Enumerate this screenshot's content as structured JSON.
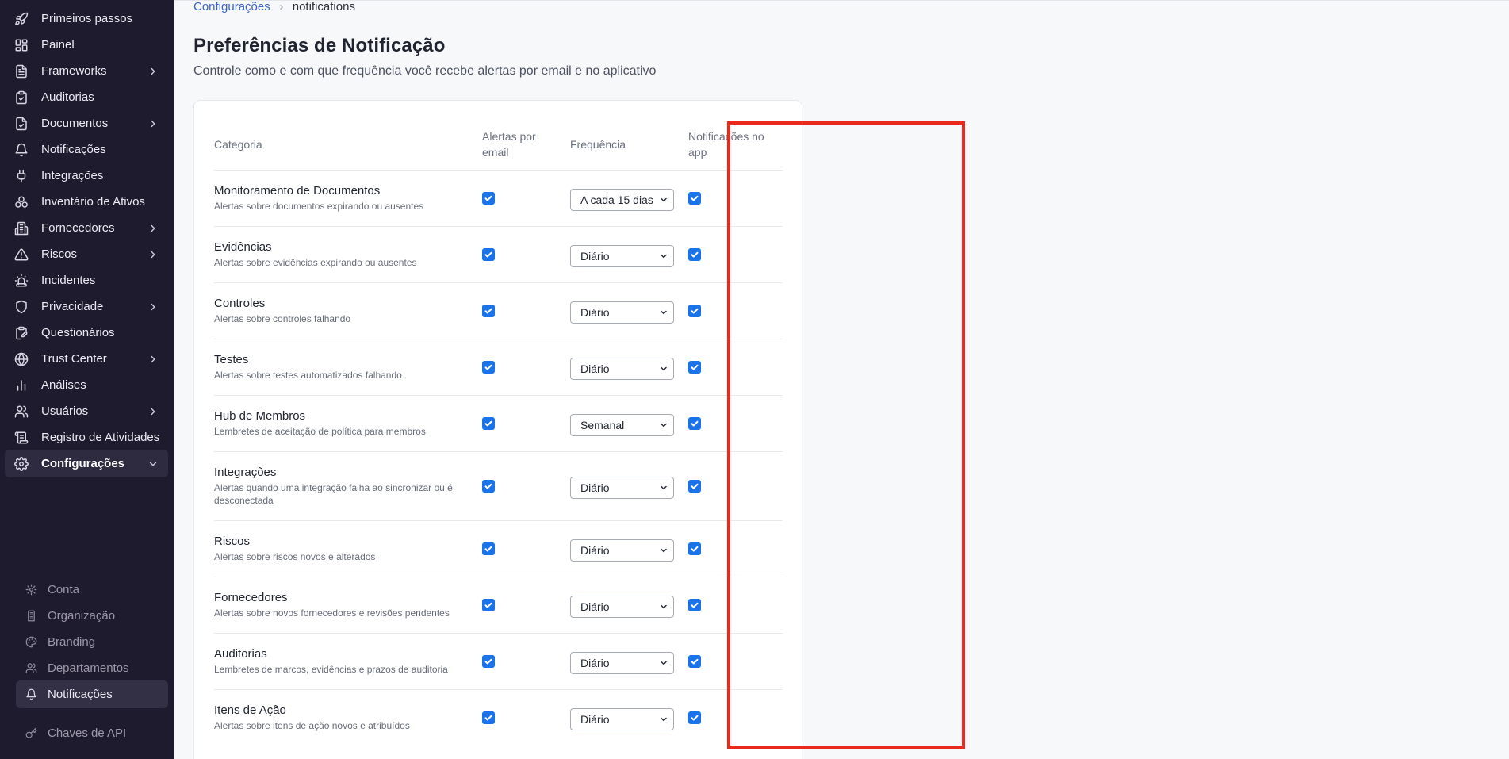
{
  "sidebar": {
    "items": [
      {
        "label": "Primeiros passos",
        "icon": "rocket-icon",
        "chevron": false
      },
      {
        "label": "Painel",
        "icon": "dashboard-icon",
        "chevron": false
      },
      {
        "label": "Frameworks",
        "icon": "file-text-icon",
        "chevron": true
      },
      {
        "label": "Auditorias",
        "icon": "clipboard-check-icon",
        "chevron": false
      },
      {
        "label": "Documentos",
        "icon": "file-check-icon",
        "chevron": true
      },
      {
        "label": "Notificações",
        "icon": "bell-icon",
        "chevron": false
      },
      {
        "label": "Integrações",
        "icon": "plug-icon",
        "chevron": false
      },
      {
        "label": "Inventário de Ativos",
        "icon": "boxes-icon",
        "chevron": false
      },
      {
        "label": "Fornecedores",
        "icon": "building-icon",
        "chevron": true
      },
      {
        "label": "Riscos",
        "icon": "warning-triangle-icon",
        "chevron": true
      },
      {
        "label": "Incidentes",
        "icon": "siren-icon",
        "chevron": false
      },
      {
        "label": "Privacidade",
        "icon": "shield-icon",
        "chevron": true
      },
      {
        "label": "Questionários",
        "icon": "clipboard-pen-icon",
        "chevron": false
      },
      {
        "label": "Trust Center",
        "icon": "globe-icon",
        "chevron": true
      },
      {
        "label": "Análises",
        "icon": "bar-chart-icon",
        "chevron": false
      },
      {
        "label": "Usuários",
        "icon": "users-icon",
        "chevron": true
      },
      {
        "label": "Registro de Atividades",
        "icon": "scroll-icon",
        "chevron": false
      },
      {
        "label": "Configurações",
        "icon": "gear-icon",
        "chevron": true,
        "expanded": true,
        "active": true
      }
    ],
    "subitems": [
      {
        "label": "Conta",
        "icon": "gear-icon"
      },
      {
        "label": "Organização",
        "icon": "building-icon"
      },
      {
        "label": "Branding",
        "icon": "palette-icon"
      },
      {
        "label": "Departamentos",
        "icon": "users-icon"
      },
      {
        "label": "Notificações",
        "icon": "bell-icon",
        "active": true
      },
      {
        "label": "Chaves de API",
        "icon": "key-icon"
      }
    ]
  },
  "breadcrumb": {
    "parent": "Configurações",
    "current": "notifications"
  },
  "page": {
    "title": "Preferências de Notificação",
    "subtitle": "Controle como e com que frequência você recebe alertas por email e no aplicativo"
  },
  "table": {
    "headers": {
      "category": "Categoria",
      "email_line1": "Alertas por",
      "email_line2": "email",
      "frequency": "Frequência",
      "inapp_line1": "Notificações no",
      "inapp_line2": "app"
    },
    "rows": [
      {
        "title": "Monitoramento de Documentos",
        "desc": "Alertas sobre documentos expirando ou ausentes",
        "email": true,
        "frequency": "A cada 15 dias",
        "in_app": true
      },
      {
        "title": "Evidências",
        "desc": "Alertas sobre evidências expirando ou ausentes",
        "email": true,
        "frequency": "Diário",
        "in_app": true
      },
      {
        "title": "Controles",
        "desc": "Alertas sobre controles falhando",
        "email": true,
        "frequency": "Diário",
        "in_app": true
      },
      {
        "title": "Testes",
        "desc": "Alertas sobre testes automatizados falhando",
        "email": true,
        "frequency": "Diário",
        "in_app": true
      },
      {
        "title": "Hub de Membros",
        "desc": "Lembretes de aceitação de política para membros",
        "email": true,
        "frequency": "Semanal",
        "in_app": true
      },
      {
        "title": "Integrações",
        "desc": "Alertas quando uma integração falha ao sincronizar ou é desconectada",
        "email": true,
        "frequency": "Diário",
        "in_app": true
      },
      {
        "title": "Riscos",
        "desc": "Alertas sobre riscos novos e alterados",
        "email": true,
        "frequency": "Diário",
        "in_app": true
      },
      {
        "title": "Fornecedores",
        "desc": "Alertas sobre novos fornecedores e revisões pendentes",
        "email": true,
        "frequency": "Diário",
        "in_app": true
      },
      {
        "title": "Auditorias",
        "desc": "Lembretes de marcos, evidências e prazos de auditoria",
        "email": true,
        "frequency": "Diário",
        "in_app": true
      },
      {
        "title": "Itens de Ação",
        "desc": "Alertas sobre itens de ação novos e atribuídos",
        "email": true,
        "frequency": "Diário",
        "in_app": true
      }
    ]
  },
  "colors": {
    "sidebar_bg": "#1f1b2e",
    "checkbox": "#1a73e8",
    "highlight": "#e8291c",
    "link": "#3b64c4"
  }
}
